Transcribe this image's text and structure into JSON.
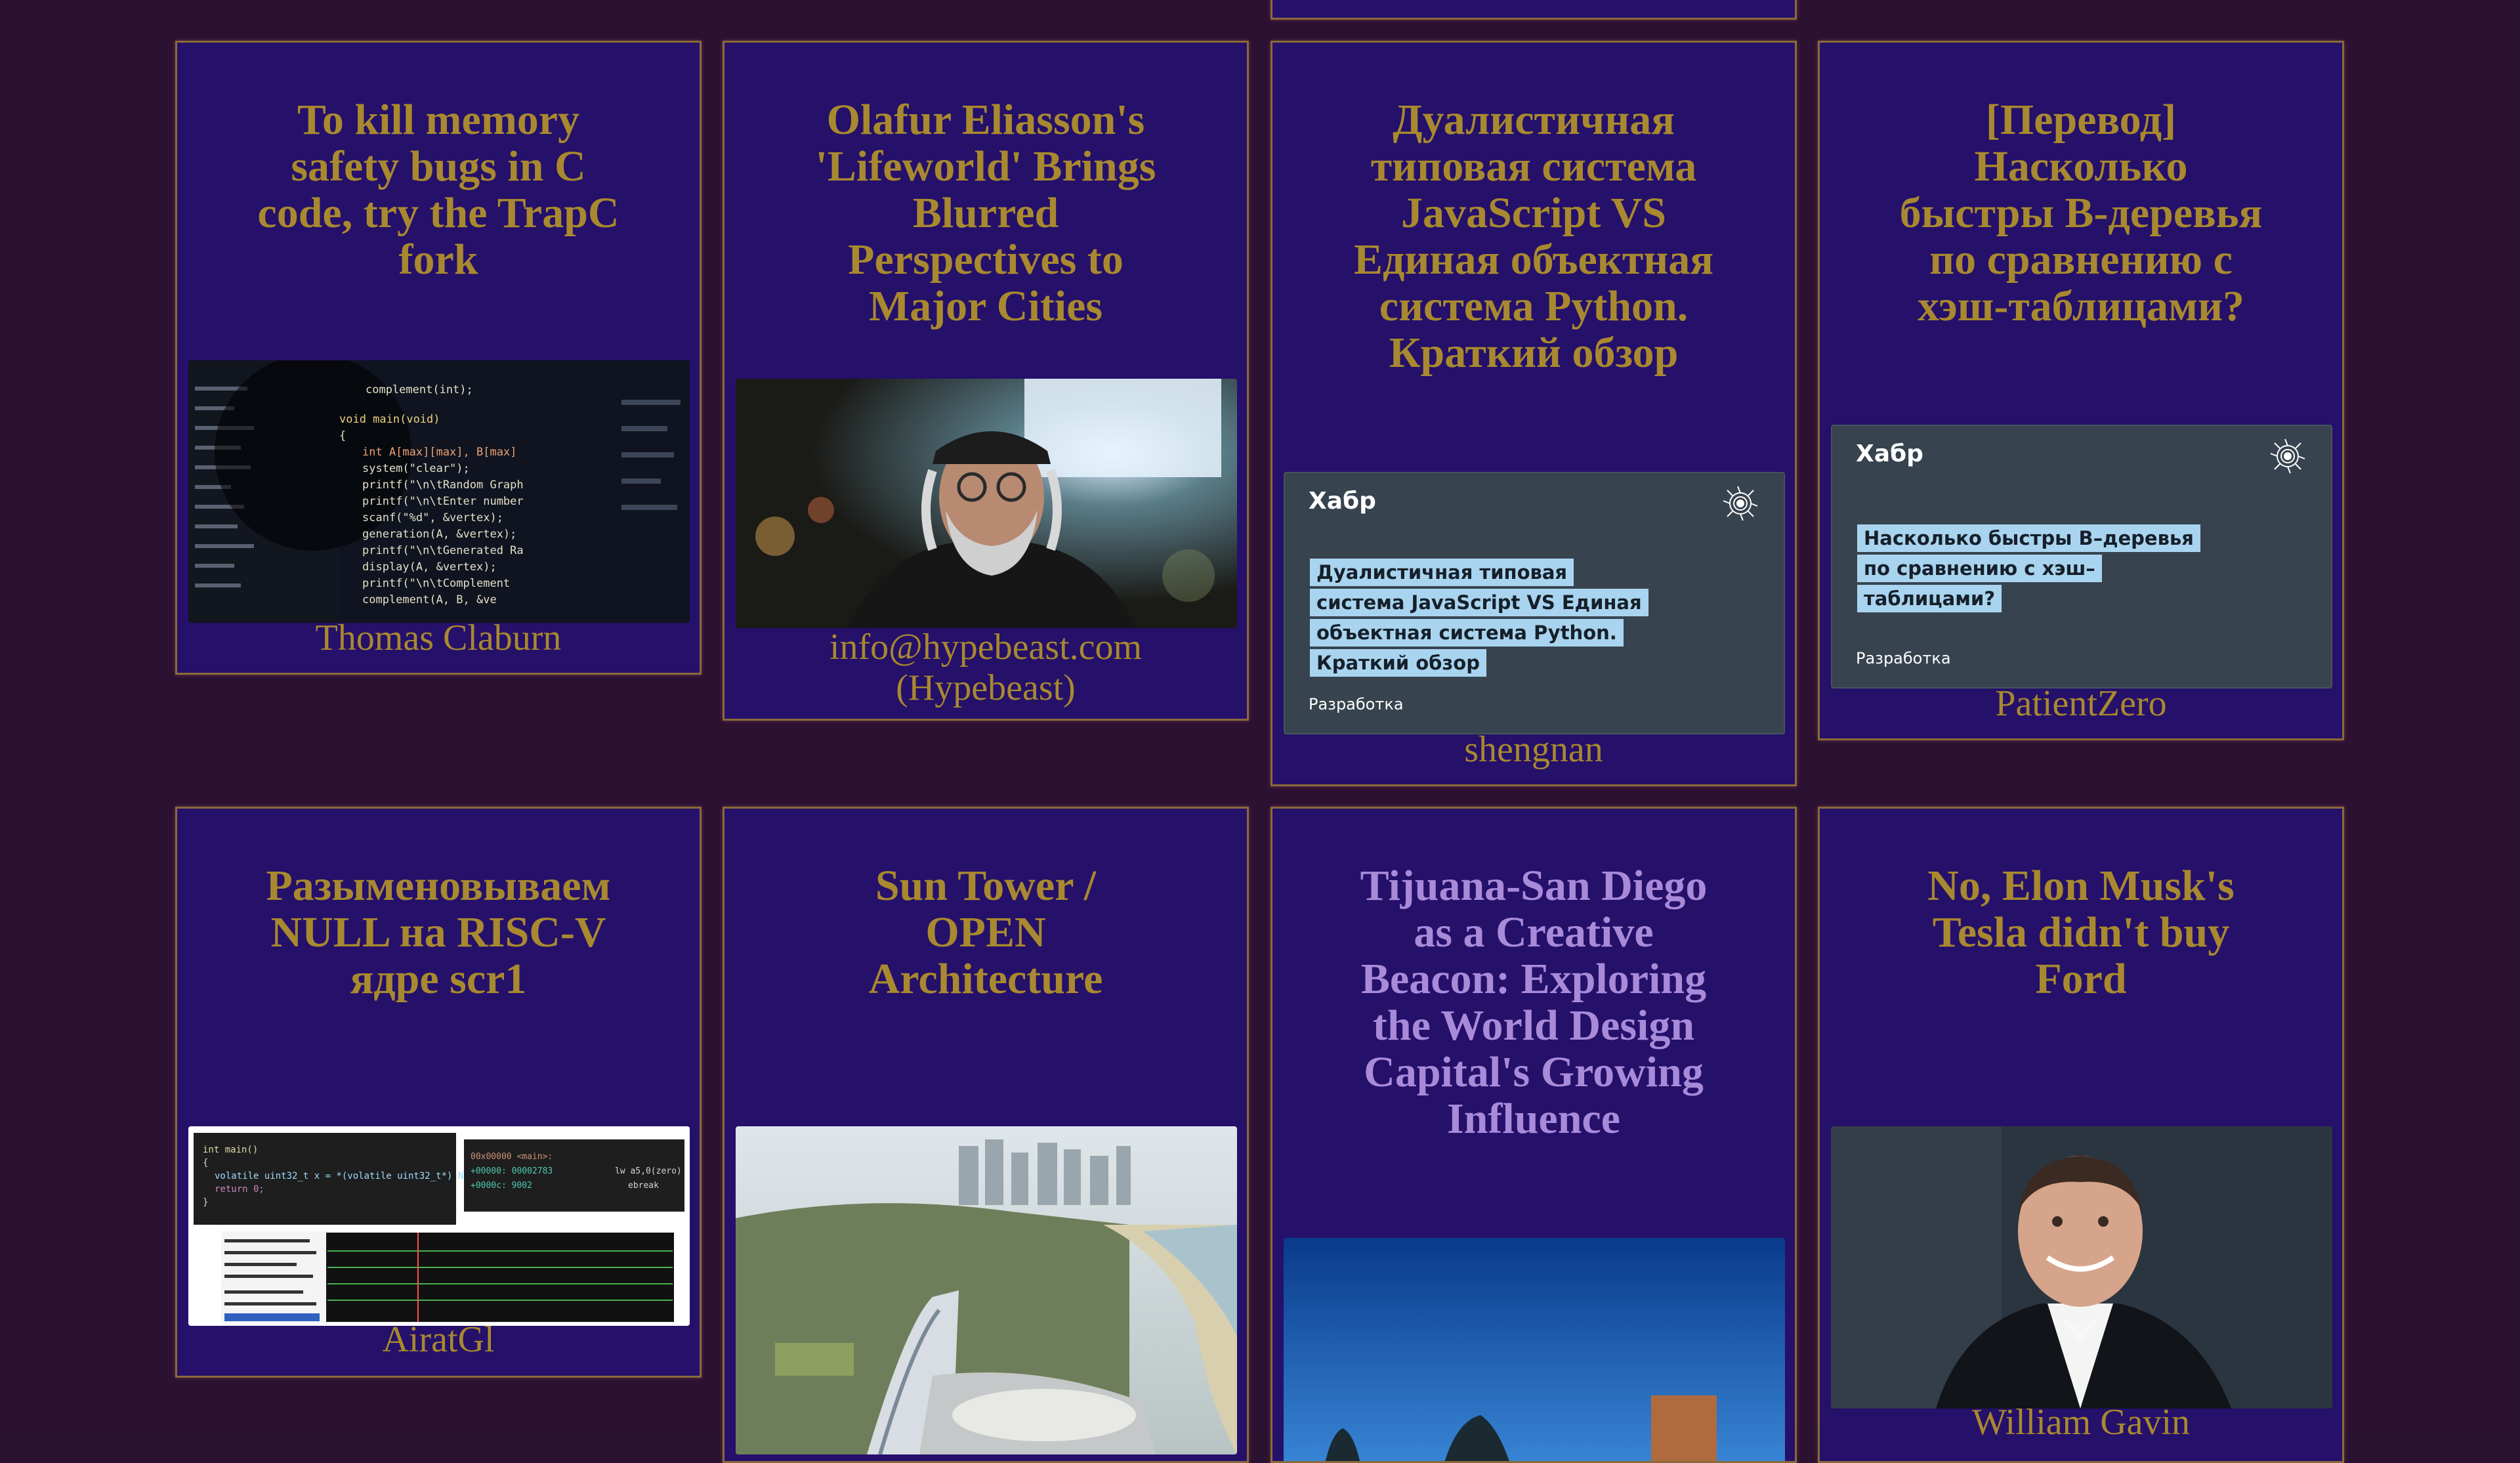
{
  "cards": [
    {
      "title": "To kill memory safety bugs in C code, try the TrapC fork",
      "author": "Thomas Claburn",
      "image": "code-magnifier-photo"
    },
    {
      "title": "Olafur Eliasson's 'Lifeworld' Brings Blurred Perspectives to Major Cities",
      "author": "info@hypebeast.com (Hypebeast)",
      "image": "portrait-photo"
    },
    {
      "title": "Дуалистичная типовая система JavaScript VS Единая объектная система Python. Краткий обзор",
      "author": "shengnan",
      "image": "habr-cover",
      "habr": {
        "brand": "Хабр",
        "text": "Дуалистичная типовая система JavaScript VS Единая объектная система Python. Краткий обзор",
        "category": "Разработка"
      }
    },
    {
      "title": "[Перевод] Насколько быстры B-деревья по сравнению с хэш-таблицами?",
      "author": "PatientZero",
      "image": "habr-cover",
      "habr": {
        "brand": "Хабр",
        "text": "Насколько быстры B–деревья по сравнению с хэш–таблицами?",
        "category": "Разработка"
      }
    },
    {
      "title": "Разыменовываем NULL на RISC-V ядре scr1",
      "author": "AiratGl",
      "image": "risc-v-debugger-screenshot"
    },
    {
      "title": "Sun Tower / OPEN Architecture",
      "author": "",
      "image": "tower-aerial-render"
    },
    {
      "title": "Tijuana-San Diego as a Creative Beacon: Exploring the World Design Capital's Growing Influence",
      "author": "",
      "image": "sky-landscape-photo"
    },
    {
      "title": "No, Elon Musk's Tesla didn't buy Ford",
      "author": "William Gavin",
      "image": "elon-musk-photo"
    }
  ],
  "colors": {
    "background": "#2c1133",
    "card": "#25106a",
    "border": "#8a6a3a",
    "title": "#a8892f",
    "title_visited": "#a88ad8"
  }
}
